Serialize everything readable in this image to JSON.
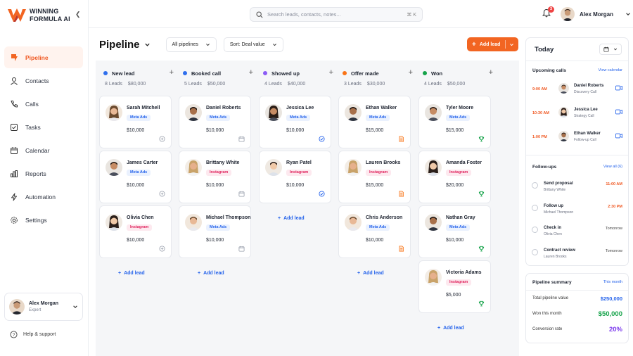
{
  "brand": {
    "line1": "WINNING",
    "line2": "FORMULA AI"
  },
  "colors": {
    "accent": "#f26522",
    "link": "#2563eb",
    "green": "#16a34a",
    "purple": "#7c3aed"
  },
  "nav": [
    {
      "label": "Pipeline",
      "icon": "pipeline-icon",
      "active": true
    },
    {
      "label": "Contacts",
      "icon": "user-icon"
    },
    {
      "label": "Calls",
      "icon": "phone-icon"
    },
    {
      "label": "Tasks",
      "icon": "checkbox-icon"
    },
    {
      "label": "Calendar",
      "icon": "calendar-icon"
    },
    {
      "label": "Reports",
      "icon": "bar-chart-icon"
    },
    {
      "label": "Automation",
      "icon": "bolt-icon"
    },
    {
      "label": "Settings",
      "icon": "gear-icon"
    }
  ],
  "sidebar_user": {
    "name": "Alex Morgan",
    "role": "Expert"
  },
  "help_label": "Help & support",
  "search": {
    "placeholder": "Search leads, contacts, notes...",
    "shortcut": "⌘ K"
  },
  "notifications": {
    "count": "3"
  },
  "top_user": {
    "name": "Alex Morgan"
  },
  "page": {
    "title": "Pipeline",
    "filter": "All pipelines",
    "sort": "Sort: Deal value",
    "add_lead": "Add lead"
  },
  "columns": [
    {
      "title": "New lead",
      "color": "#2f6fed",
      "leads": "8 Leads",
      "total": "$80,000",
      "add": "Add lead",
      "cards": [
        {
          "name": "Sarah Mitchell",
          "source": "Meta Ads",
          "value": "$10,000",
          "icon": "add-circle-icon"
        },
        {
          "name": "James Carter",
          "source": "Meta Ads",
          "value": "$10,000",
          "icon": "add-circle-icon"
        },
        {
          "name": "Olivia Chen",
          "source": "Instagram",
          "value": "$10,000",
          "icon": "add-circle-icon"
        }
      ]
    },
    {
      "title": "Booked call",
      "color": "#2f6fed",
      "leads": "5 Leads",
      "total": "$50,000",
      "add": "Add lead",
      "cards": [
        {
          "name": "Daniel Roberts",
          "source": "Meta Ads",
          "value": "$10,000",
          "icon": "calendar-icon"
        },
        {
          "name": "Brittany White",
          "source": "Instagram",
          "value": "$10,000",
          "icon": "calendar-icon"
        },
        {
          "name": "Michael Thompson",
          "source": "Meta Ads",
          "value": "$10,000",
          "icon": "calendar-icon"
        }
      ]
    },
    {
      "title": "Showed up",
      "color": "#8b5cf6",
      "leads": "4 Leads",
      "total": "$40,000",
      "add": "Add lead",
      "cards": [
        {
          "name": "Jessica Lee",
          "source": "Meta Ads",
          "value": "$10,000",
          "icon": "check-circle-icon"
        },
        {
          "name": "Ryan Patel",
          "source": "Instagram",
          "value": "$10,000",
          "icon": "check-circle-icon"
        }
      ]
    },
    {
      "title": "Offer made",
      "color": "#f97316",
      "leads": "3 Leads",
      "total": "$30,000",
      "add": "Add lead",
      "cards": [
        {
          "name": "Ethan Walker",
          "source": "Meta Ads",
          "value": "$15,000",
          "icon": "document-icon"
        },
        {
          "name": "Lauren Brooks",
          "source": "Instagram",
          "value": "$15,000",
          "icon": "document-icon"
        },
        {
          "name": "Chris Anderson",
          "source": "Meta Ads",
          "value": "$10,000",
          "icon": "document-icon"
        }
      ]
    },
    {
      "title": "Won",
      "color": "#16a34a",
      "leads": "4 Leads",
      "total": "$50,000",
      "add": "Add lead",
      "cards": [
        {
          "name": "Tyler Moore",
          "source": "Meta Ads",
          "value": "$15,000",
          "icon": "trophy-icon"
        },
        {
          "name": "Amanda Foster",
          "source": "Instagram",
          "value": "$20,000",
          "icon": "trophy-icon"
        },
        {
          "name": "Nathan Gray",
          "source": "Meta Ads",
          "value": "$10,000",
          "icon": "trophy-icon"
        },
        {
          "name": "Victoria Adams",
          "source": "Instagram",
          "value": "$5,000",
          "icon": "trophy-icon"
        }
      ]
    }
  ],
  "right": {
    "today": "Today",
    "calls_title": "Upcoming calls",
    "calls_link": "View calendar",
    "calls": [
      {
        "time": "9:00 AM",
        "name": "Daniel Roberts",
        "type": "Discovery Call"
      },
      {
        "time": "10:30 AM",
        "name": "Jessica Lee",
        "type": "Strategy Call"
      },
      {
        "time": "1:00 PM",
        "name": "Ethan Walker",
        "type": "Follow-up Call"
      }
    ],
    "followups_title": "Follow-ups",
    "followups_link": "View all (6)",
    "followups": [
      {
        "title": "Send proposal",
        "who": "Brittany White",
        "when": "11:00 AM",
        "urgent": true
      },
      {
        "title": "Follow up",
        "who": "Michael Thompson",
        "when": "2:30 PM",
        "urgent": true
      },
      {
        "title": "Check in",
        "who": "Olivia Chen",
        "when": "Tomorrow",
        "urgent": false
      },
      {
        "title": "Contract review",
        "who": "Lauren Brooks",
        "when": "Tomorrow",
        "urgent": false
      }
    ],
    "summary_title": "Pipeline summary",
    "summary_link": "This month",
    "summary": [
      {
        "label": "Total pipeline value",
        "value": "$250,000"
      },
      {
        "label": "Won this month",
        "value": "$50,000"
      },
      {
        "label": "Conversion rate",
        "value": "20%"
      }
    ]
  }
}
